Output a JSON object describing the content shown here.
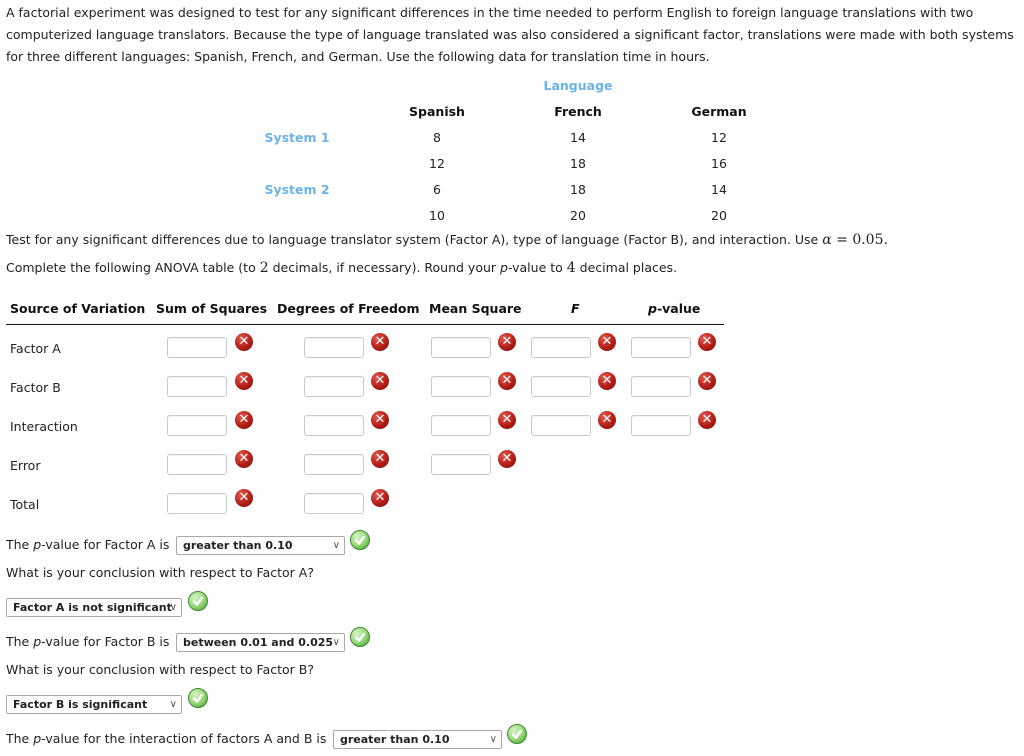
{
  "intro": {
    "paragraph": "A factorial experiment was designed to test for any significant differences in the time needed to perform English to foreign language translations with two computerized language translators. Because the type of language translated was also considered a significant factor, translations were made with both systems for three different languages: Spanish, French, and German. Use the following data for translation time in hours."
  },
  "data_table": {
    "factor_b_label": "Language",
    "columns": [
      "Spanish",
      "French",
      "German"
    ],
    "rows": [
      {
        "system": "System 1",
        "values": [
          "8",
          "14",
          "12"
        ]
      },
      {
        "system": "",
        "values": [
          "12",
          "18",
          "16"
        ]
      },
      {
        "system": "System 2",
        "values": [
          "6",
          "18",
          "14"
        ]
      },
      {
        "system": "",
        "values": [
          "10",
          "20",
          "20"
        ]
      }
    ]
  },
  "instructions": {
    "line1_prefix": "Test for any significant differences due to language translator system (Factor A), type of language (Factor B), and interaction. Use ",
    "alpha_symbol": "α",
    "alpha_eq": " = 0.05",
    "line1_suffix": ".",
    "line2_a": "Complete the following ANOVA table (to ",
    "line2_decimals": "2",
    "line2_b": " decimals, if necessary). Round your ",
    "line2_p": "p",
    "line2_c": "-value to ",
    "line2_places": "4",
    "line2_d": " decimal places."
  },
  "anova": {
    "headers": {
      "source": "Source of Variation",
      "ss": "Sum of Squares",
      "df": "Degrees of Freedom",
      "ms": "Mean Square",
      "f": "F",
      "p_italic": "p",
      "p_rest": "-value"
    },
    "rows": [
      {
        "label": "Factor A",
        "ss": "",
        "df": "",
        "ms": "",
        "f": "",
        "p": ""
      },
      {
        "label": "Factor B",
        "ss": "",
        "df": "",
        "ms": "",
        "f": "",
        "p": ""
      },
      {
        "label": "Interaction",
        "ss": "",
        "df": "",
        "ms": "",
        "f": "",
        "p": ""
      },
      {
        "label": "Error",
        "ss": "",
        "df": "",
        "ms": ""
      },
      {
        "label": "Total",
        "ss": "",
        "df": ""
      }
    ],
    "status_icon": "incorrect-x",
    "status_color": "#b31d17"
  },
  "questions": {
    "pa_prefix": "The ",
    "p": "p",
    "pa_suffix": "-value for Factor A is",
    "pa_selected": "greater than 0.10",
    "concl_a_q": "What is your conclusion with respect to Factor A?",
    "concl_a_selected": "Factor A is not significant",
    "pb_suffix": "-value for Factor B is",
    "pb_selected": "between 0.01 and 0.025",
    "concl_b_q": "What is your conclusion with respect to Factor B?",
    "concl_b_selected": "Factor B is significant",
    "pi_suffix": "-value for the interaction of factors A and B is",
    "pi_selected": "greater than 0.10",
    "correct_icon": "correct-check",
    "correct_color": "#3f9a2a"
  }
}
